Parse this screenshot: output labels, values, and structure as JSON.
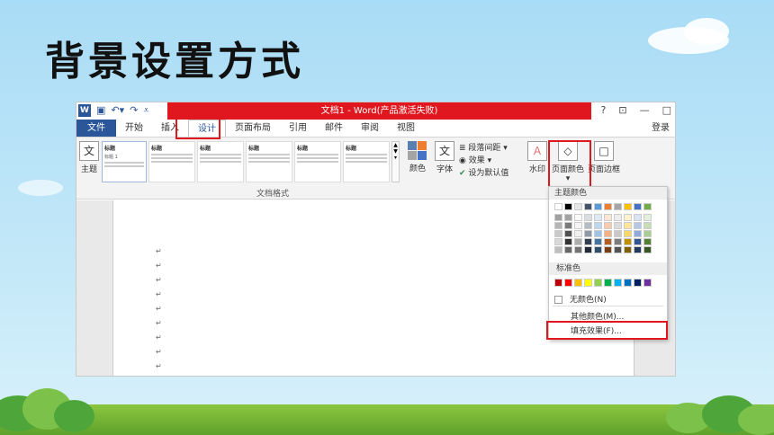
{
  "slide": {
    "title": "背景设置方式"
  },
  "word": {
    "window_title": "文档1 - Word(产品激活失败)",
    "window_controls": [
      "?",
      "⊡",
      "—",
      "□"
    ],
    "login": "登录",
    "tabs": [
      "文件",
      "开始",
      "插入",
      "设计",
      "页面布局",
      "引用",
      "邮件",
      "审阅",
      "视图"
    ],
    "active_tab": "设计",
    "ribbon": {
      "theme_label": "主题",
      "gallery": [
        {
          "heading": "标题",
          "sub": "标题 1",
          "selected": true
        },
        {
          "heading": "标题",
          "sub": "",
          "selected": false
        },
        {
          "heading": "标题",
          "sub": "",
          "selected": false
        },
        {
          "heading": "标题",
          "sub": "",
          "selected": false
        },
        {
          "heading": "标题",
          "sub": "",
          "selected": false
        },
        {
          "heading": "标题",
          "sub": "",
          "selected": false
        }
      ],
      "group_label": "文档格式",
      "colors_label": "颜色",
      "fonts_label": "字体",
      "paragraph_spacing": "段落间距",
      "effects": "效果",
      "set_default": "设为默认值",
      "watermark": "水印",
      "page_color": "页面颜色",
      "page_borders": "页面边框"
    },
    "page_marks": [
      "↵",
      "↵",
      "↵",
      "↵",
      "↵",
      "↵",
      "↵",
      "↵",
      "↵"
    ]
  },
  "dropdown": {
    "theme_colors_label": "主题颜色",
    "theme_top_row": [
      "#ffffff",
      "#000000",
      "#e7e6e6",
      "#44546a",
      "#5b9bd5",
      "#ed7d31",
      "#a5a5a5",
      "#ffc000",
      "#4472c4",
      "#70ad47"
    ],
    "standard_label": "标准色",
    "standard_colors": [
      "#c00000",
      "#ff0000",
      "#ffc000",
      "#ffff00",
      "#92d050",
      "#00b050",
      "#00b0f0",
      "#0070c0",
      "#002060",
      "#7030a0"
    ],
    "no_color": "无颜色(N)",
    "more_colors": "其他颜色(M)...",
    "fill_effects": "填充效果(F)..."
  },
  "colors": {
    "accent": "#2b579a",
    "highlight": "#e0171e"
  }
}
